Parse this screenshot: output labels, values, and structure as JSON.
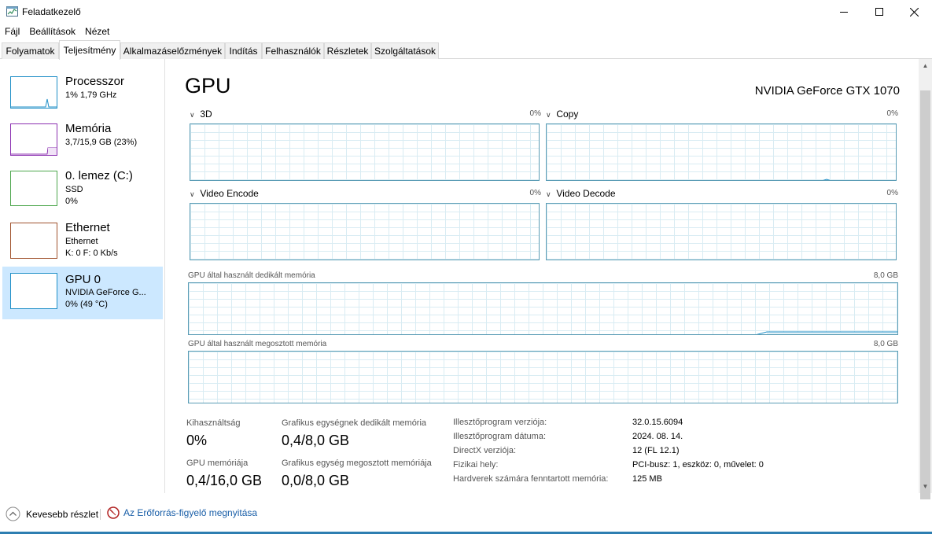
{
  "window": {
    "title": "Feladatkezelő"
  },
  "menu": [
    "Fájl",
    "Beállítások",
    "Nézet"
  ],
  "tabs": [
    "Folyamatok",
    "Teljesítmény",
    "Alkalmazáselőzmények",
    "Indítás",
    "Felhasználók",
    "Részletek",
    "Szolgáltatások"
  ],
  "active_tab": "Teljesítmény",
  "resources": [
    {
      "name": "Processzor",
      "sub1": "1% 1,79 GHz",
      "sub2": "",
      "color": "#1f8fc7"
    },
    {
      "name": "Memória",
      "sub1": "3,7/15,9 GB (23%)",
      "sub2": "",
      "color": "#8b2fb0"
    },
    {
      "name": "0. lemez (C:)",
      "sub1": "SSD",
      "sub2": "0%",
      "color": "#4ca64c"
    },
    {
      "name": "Ethernet",
      "sub1": "Ethernet",
      "sub2": "K: 0 F: 0 Kb/s",
      "color": "#a0522d"
    },
    {
      "name": "GPU 0",
      "sub1": "NVIDIA GeForce G...",
      "sub2": "0% (49 °C)",
      "color": "#1f8fc7"
    }
  ],
  "gpu": {
    "title": "GPU",
    "model": "NVIDIA GeForce GTX 1070",
    "engines": [
      {
        "label": "3D",
        "pct": "0%"
      },
      {
        "label": "Copy",
        "pct": "0%"
      },
      {
        "label": "Video Encode",
        "pct": "0%"
      },
      {
        "label": "Video Decode",
        "pct": "0%"
      }
    ],
    "dedicated_label": "GPU által használt dedikált memória",
    "dedicated_max": "8,0 GB",
    "shared_label": "GPU által használt megosztott memória",
    "shared_max": "8,0 GB"
  },
  "stats": {
    "utilization_label": "Kihasználtság",
    "utilization_value": "0%",
    "dedicated_mem_label": "Grafikus egységnek dedikált memória",
    "dedicated_mem_value": "0,4/8,0 GB",
    "gpu_mem_label": "GPU memóriája",
    "gpu_mem_value": "0,4/16,0 GB",
    "shared_mem_label": "Grafikus egység megosztott memóriája",
    "shared_mem_value": "0,0/8,0 GB"
  },
  "info": [
    {
      "label": "Illesztőprogram verziója:",
      "value": "32.0.15.6094"
    },
    {
      "label": "Illesztőprogram dátuma:",
      "value": "2024. 08. 14."
    },
    {
      "label": "DirectX verziója:",
      "value": "12 (FL 12.1)"
    },
    {
      "label": "Fizikai hely:",
      "value": "PCI-busz: 1, eszköz: 0, művelet: 0"
    },
    {
      "label": "Hardverek számára fenntartott memória:",
      "value": "125 MB"
    }
  ],
  "footer": {
    "less_details": "Kevesebb részlet",
    "open_monitor": "Az Erőforrás-figyelő megnyitása"
  },
  "icons": {
    "app": "task-manager-icon",
    "minimize": "minimize-icon",
    "maximize": "maximize-icon",
    "close": "close-icon",
    "less_details": "chevron-up-icon",
    "resource_monitor": "resource-monitor-icon"
  },
  "colors": {
    "accent": "#2d7eb1",
    "selected": "#cce8ff",
    "graph_border": "#5a9cb5",
    "link": "#1a5fa8"
  }
}
